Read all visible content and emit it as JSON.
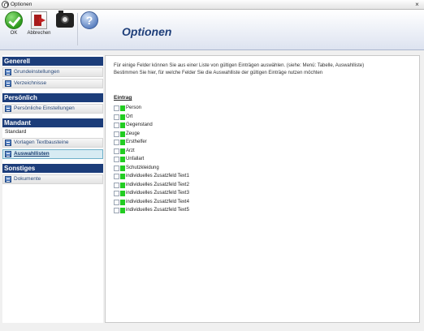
{
  "window": {
    "title": "Optionen",
    "close_glyph": "×"
  },
  "toolbar": {
    "ok_label": "OK",
    "cancel_label": "Abbrechen",
    "heading": "Optionen"
  },
  "sidebar": {
    "sections": [
      {
        "title": "Generell",
        "items": [
          {
            "label": "Grundeinstellungen"
          },
          {
            "label": "Verzeichnisse"
          }
        ]
      },
      {
        "title": "Persönlich",
        "items": [
          {
            "label": "Persönliche Einstellungen"
          }
        ]
      },
      {
        "title": "Mandant",
        "plain": "Standard",
        "items": [
          {
            "label": "Vorlagen Textbausteine"
          },
          {
            "label": "Auswahllisten",
            "active": true
          }
        ]
      },
      {
        "title": "Sonstiges",
        "items": [
          {
            "label": "Dokumente"
          }
        ]
      }
    ]
  },
  "main": {
    "intro_line1": "Für einige Felder können Sie aus einer Liste von gültigen Einträgen auswählen. (siehe: Menü: Tabelle, Auswahlliste)",
    "intro_line2": "Bestimmen Sie hier, für welche Felder Sie  die Auswahlliste der gültigen Einträge nutzen möchten",
    "column_header": "Eintrag",
    "entries": [
      "Person",
      "Ort",
      "Gegenstand",
      "Zeuge",
      "Ersthelfer",
      "Arzt",
      "Unfallart",
      "Schutzkleidung",
      "individuelles Zusatzfeld Text1",
      "individuelles Zusatzfeld Text2",
      "individuelles Zusatzfeld Text3",
      "individuelles Zusatzfeld Text4",
      "individuelles Zusatzfeld Text5"
    ],
    "swatch_color": "#22cc22"
  }
}
